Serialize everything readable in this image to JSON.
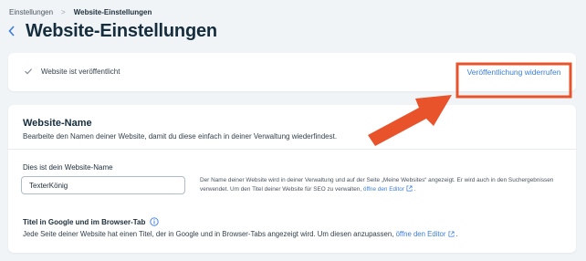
{
  "breadcrumb": {
    "parent": "Einstellungen",
    "separator": ">",
    "current": "Website-Einstellungen"
  },
  "header": {
    "back_icon": "chevron-left-icon",
    "title": "Website-Einstellungen"
  },
  "status": {
    "icon": "check-icon",
    "text": "Website ist veröffentlicht",
    "action_label": "Veröffentlichung widerrufen"
  },
  "website_name": {
    "title": "Website-Name",
    "subtitle": "Bearbeite den Namen deiner Website, damit du diese einfach in deiner Verwaltung wiederfindest.",
    "field_label": "Dies ist dein Website-Name",
    "field_value": "TexterKönig",
    "help_text": "Der Name deiner Website wird in deiner Verwaltung und auf der Seite „Meine Websites“ angezeigt. Er wird auch in den Suchergebnissen verwendet. Um den Titel deiner Website für SEO zu verwalten,",
    "help_link": "öffne den Editor",
    "help_end": "."
  },
  "browser_tab": {
    "title": "Titel in Google und im Browser-Tab",
    "info_icon": "info-icon",
    "description": "Jede Seite deiner Website hat einen Titel, der in Google und in Browser-Tabs angezeigt wird. Um diesen anzupassen,",
    "link": "öffne den Editor",
    "end": "."
  },
  "colors": {
    "accent": "#3b7ddd",
    "annotation": "#e8532b",
    "background": "#f0f4f7"
  }
}
